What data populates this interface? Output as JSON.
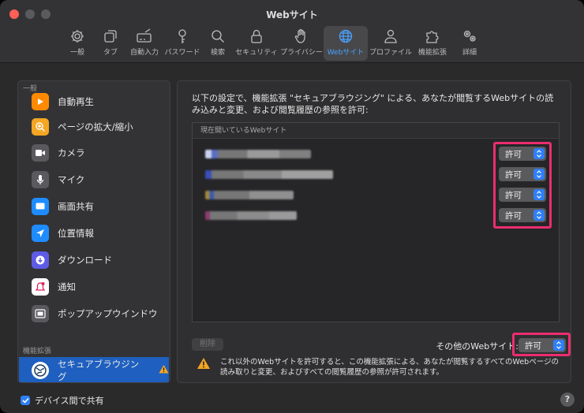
{
  "window": {
    "title": "Webサイト"
  },
  "toolbar": {
    "items": [
      {
        "label": "一般",
        "icon": "gear-icon"
      },
      {
        "label": "タブ",
        "icon": "tabs-icon"
      },
      {
        "label": "自動入力",
        "icon": "autofill-icon"
      },
      {
        "label": "パスワード",
        "icon": "key-icon"
      },
      {
        "label": "検索",
        "icon": "search-icon"
      },
      {
        "label": "セキュリティ",
        "icon": "lock-icon"
      },
      {
        "label": "プライバシー",
        "icon": "hand-icon"
      },
      {
        "label": "Webサイト",
        "icon": "globe-icon",
        "active": true
      },
      {
        "label": "プロファイル",
        "icon": "person-icon"
      },
      {
        "label": "機能拡張",
        "icon": "puzzle-icon"
      },
      {
        "label": "詳細",
        "icon": "gears-icon"
      }
    ]
  },
  "sidebar": {
    "header_general": "一般",
    "items": [
      {
        "label": "自動再生",
        "icon": "play-icon",
        "color": "#ff8a00"
      },
      {
        "label": "ページの拡大/縮小",
        "icon": "zoom-icon",
        "color": "#f5a623"
      },
      {
        "label": "カメラ",
        "icon": "camera-icon",
        "color": "#5a5a5e"
      },
      {
        "label": "マイク",
        "icon": "microphone-icon",
        "color": "#5a5a5e"
      },
      {
        "label": "画面共有",
        "icon": "screen-share-icon",
        "color": "#1e8cff"
      },
      {
        "label": "位置情報",
        "icon": "location-icon",
        "color": "#1e8cff"
      },
      {
        "label": "ダウンロード",
        "icon": "download-icon",
        "color": "#5e5ce6"
      },
      {
        "label": "通知",
        "icon": "notification-icon",
        "color": "#ffffff"
      },
      {
        "label": "ポップアップウインドウ",
        "icon": "popup-window-icon",
        "color": "#5a5a5e"
      }
    ],
    "header_extensions": "機能拡張",
    "extension": {
      "label": "セキュアブラウジング",
      "icon": "secure-browsing-icon"
    }
  },
  "panel": {
    "description": "以下の設定で、機能拡張 \"セキュアブラウジング\" による、あなたが閲覧するWebサイトの読み込みと変更、および閲覧履歴の参照を許可:",
    "table_header": "現在開いているWebサイト",
    "sites": [
      {
        "permission": "許可"
      },
      {
        "permission": "許可"
      },
      {
        "permission": "許可"
      },
      {
        "permission": "許可"
      }
    ],
    "delete_label": "削除",
    "other_sites_label": "その他のWebサイト:",
    "other_sites_value": "許可",
    "warning_text": "これ以外のWebサイトを許可すると、この機能拡張による、あなたが閲覧するすべてのWebページの読み取りと変更、およびすべての閲覧履歴の参照が許可されます。"
  },
  "footer": {
    "share_label": "デバイス間で共有",
    "help": "?"
  },
  "colors": {
    "accent": "#2f7ff5",
    "highlight": "#ec2d6e",
    "selection": "#1e5fbf"
  }
}
